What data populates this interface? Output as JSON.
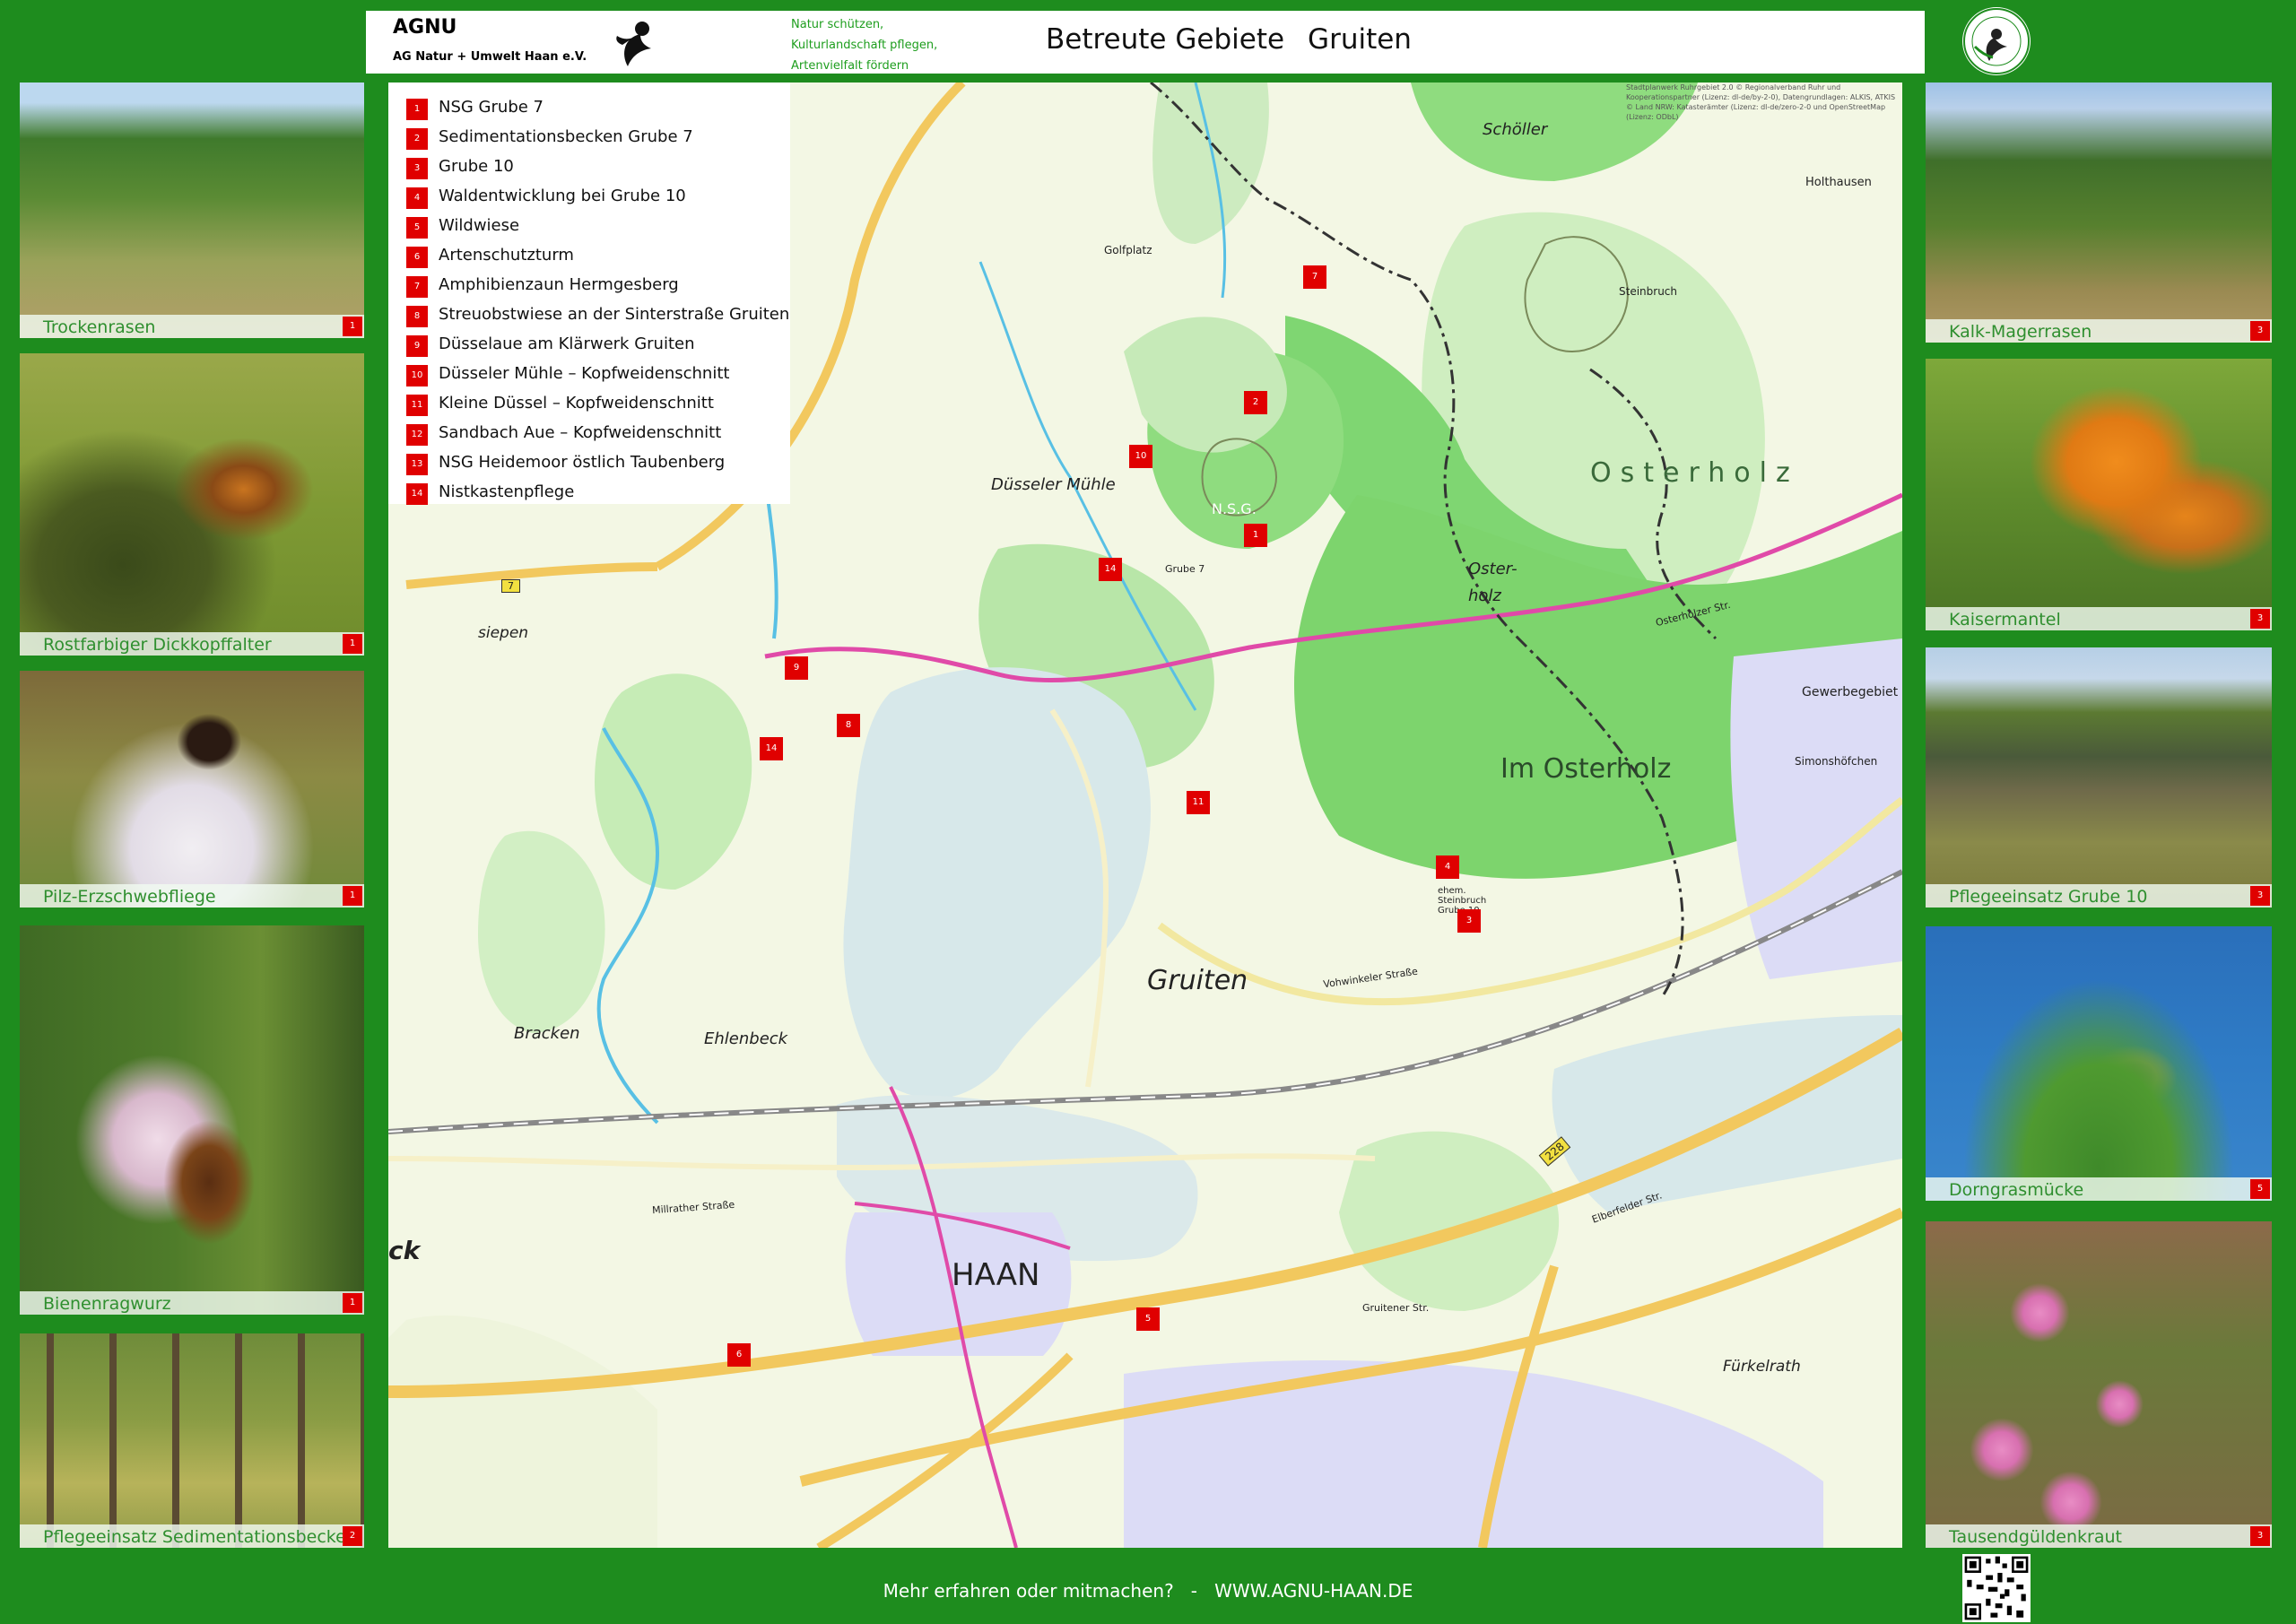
{
  "header": {
    "org_name": "AGNU",
    "org_full": "AG Natur + Umwelt Haan e.V.",
    "slogan": [
      "Natur schützen,",
      "Kulturlandschaft pflegen,",
      "Artenvielfalt fördern"
    ],
    "title_left": "Betreute Gebiete",
    "title_right": "Gruiten"
  },
  "colors": {
    "brand_green": "#1e8c1e",
    "marker_red": "#e00000",
    "caption_green": "#2f8f2f"
  },
  "photos_left": [
    {
      "caption": "Trockenrasen",
      "num": "1"
    },
    {
      "caption": "Rostfarbiger Dickkopffalter",
      "num": "1"
    },
    {
      "caption": "Pilz-Erzschwebfliege",
      "num": "1"
    },
    {
      "caption": "Bienenragwurz",
      "num": "1"
    },
    {
      "caption": "Pflegeeinsatz Sedimentationsbecken",
      "num": "2"
    }
  ],
  "photos_right": [
    {
      "caption": "Kalk-Magerrasen",
      "num": "3"
    },
    {
      "caption": "Kaisermantel",
      "num": "3"
    },
    {
      "caption": "Pflegeeinsatz Grube 10",
      "num": "3"
    },
    {
      "caption": "Dorngrasmücke",
      "num": "5"
    },
    {
      "caption": "Tausendgüldenkraut",
      "num": "3"
    }
  ],
  "legend": [
    {
      "num": "1",
      "label": "NSG Grube 7"
    },
    {
      "num": "2",
      "label": "Sedimentationsbecken Grube 7"
    },
    {
      "num": "3",
      "label": "Grube 10"
    },
    {
      "num": "4",
      "label": "Waldentwicklung bei Grube 10"
    },
    {
      "num": "5",
      "label": "Wildwiese"
    },
    {
      "num": "6",
      "label": "Artenschutzturm"
    },
    {
      "num": "7",
      "label": "Amphibienzaun Hermgesberg"
    },
    {
      "num": "8",
      "label": "Streuobstwiese an der Sinterstraße Gruiten"
    },
    {
      "num": "9",
      "label": "Düsselaue am Klärwerk Gruiten"
    },
    {
      "num": "10",
      "label": "Düsseler Mühle – Kopfweidenschnitt"
    },
    {
      "num": "11",
      "label": "Kleine Düssel – Kopfweidenschnitt"
    },
    {
      "num": "12",
      "label": "Sandbach Aue – Kopfweidenschnitt"
    },
    {
      "num": "13",
      "label": "NSG Heidemoor östlich Taubenberg"
    },
    {
      "num": "14",
      "label": "Nistkastenpflege"
    }
  ],
  "map": {
    "markers": [
      "7",
      "2",
      "10",
      "1",
      "14",
      "9",
      "8",
      "14",
      "11",
      "4",
      "3",
      "5",
      "6"
    ],
    "place_labels": {
      "gruiten": "Gruiten",
      "haan": "HAAN",
      "osterholz": "Osterholz",
      "im_osterholz": "Im Osterholz",
      "scholler": "Schöller",
      "duesseler_muehle": "Düsseler Mühle",
      "ehlenbeck": "Ehlenbeck",
      "bracken": "Bracken",
      "siepen": "siepen",
      "furkelrath": "Fürkelrath",
      "golfplatz": "Golfplatz",
      "steinbruch": "Steinbruch",
      "oster_holz": "Oster-holz",
      "nsg": "N.S.G.",
      "grube7": "Grube 7",
      "grube10": "ehem. Steinbruch Grube 10",
      "gewerbegebiet": "Gewerbegebiet",
      "holthausen": "Holthausen",
      "simonshoefchen": "Simonshöfchen",
      "ck": "ck"
    },
    "street_labels": {
      "osterholzer": "Osterholzer Str.",
      "millrather": "Millrather Straße",
      "gruitener": "Gruitener Str.",
      "vohwinkeler": "Vohwinkeler Straße",
      "elberfelder": "Elberfelder Str.",
      "road_7": "7",
      "road_228": "228"
    },
    "attribution": "Stadtplanwerk Ruhrgebiet 2.0 © Regionalverband Ruhr und Kooperationspartner (Lizenz: dl-de/by-2-0), Datengrundlagen: ALKIS, ATKIS © Land NRW: Katasterämter (Lizenz: dl-de/zero-2-0 und OpenStreetMap (Lizenz: ODbL)"
  },
  "footer": {
    "text": "Mehr erfahren oder mitmachen?   -   WWW.AGNU-HAAN.DE"
  }
}
